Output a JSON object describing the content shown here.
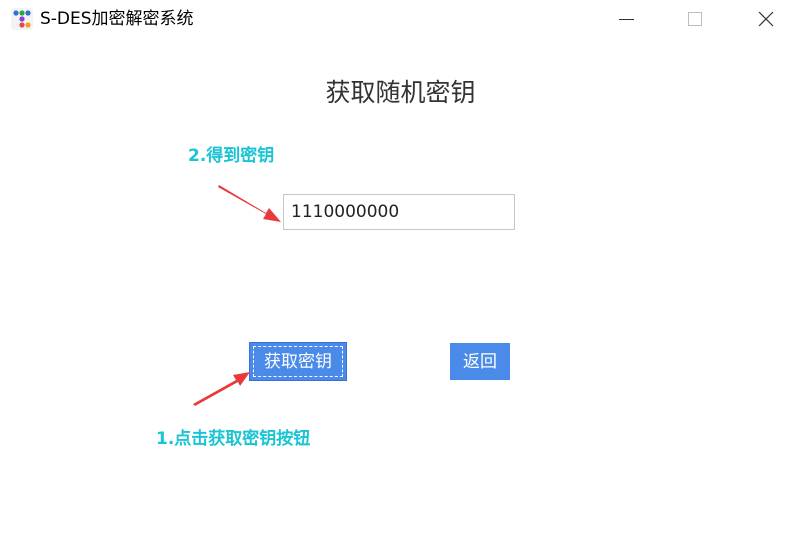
{
  "window": {
    "title": "S-DES加密解密系统",
    "icon": "app-dots-icon"
  },
  "window_controls": {
    "minimize_icon": "minimize-icon",
    "maximize_icon": "maximize-icon",
    "close_icon": "close-icon"
  },
  "page": {
    "heading": "获取随机密钥"
  },
  "key_field": {
    "value": "1110000000"
  },
  "buttons": {
    "get_key": "获取密钥",
    "back": "返回"
  },
  "annotations": {
    "step2": "2.得到密钥",
    "step1": "1.点击获取密钥按钮",
    "arrow_color": "#e83a3a"
  },
  "colors": {
    "button_bg": "#4a8bea",
    "annotation_text": "#19c5d4"
  }
}
